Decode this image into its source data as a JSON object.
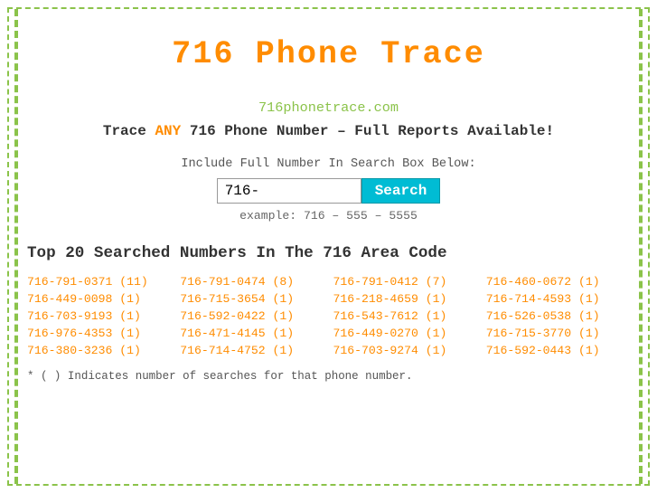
{
  "title": "716 Phone Trace",
  "site_url": "716phonetrace.com",
  "tagline_prefix": "Trace ",
  "tagline_highlight": "ANY",
  "tagline_suffix": " 716 Phone Number – Full Reports Available!",
  "search": {
    "label": "Include Full Number In Search Box Below:",
    "input_value": "716-",
    "button_label": "Search",
    "example": "example: 716 – 555 – 5555"
  },
  "top20_title": "Top 20 Searched Numbers In The 716 Area Code",
  "numbers": [
    "716-791-0371 (11)",
    "716-791-0474 (8)",
    "716-791-0412 (7)",
    "716-460-0672 (1)",
    "716-449-0098 (1)",
    "716-715-3654 (1)",
    "716-218-4659 (1)",
    "716-714-4593 (1)",
    "716-703-9193 (1)",
    "716-592-0422 (1)",
    "716-543-7612 (1)",
    "716-526-0538 (1)",
    "716-976-4353 (1)",
    "716-471-4145 (1)",
    "716-449-0270 (1)",
    "716-715-3770 (1)",
    "716-380-3236 (1)",
    "716-714-4752 (1)",
    "716-703-9274 (1)",
    "716-592-0443 (1)"
  ],
  "footnote": "* ( ) Indicates number of searches for that phone number."
}
